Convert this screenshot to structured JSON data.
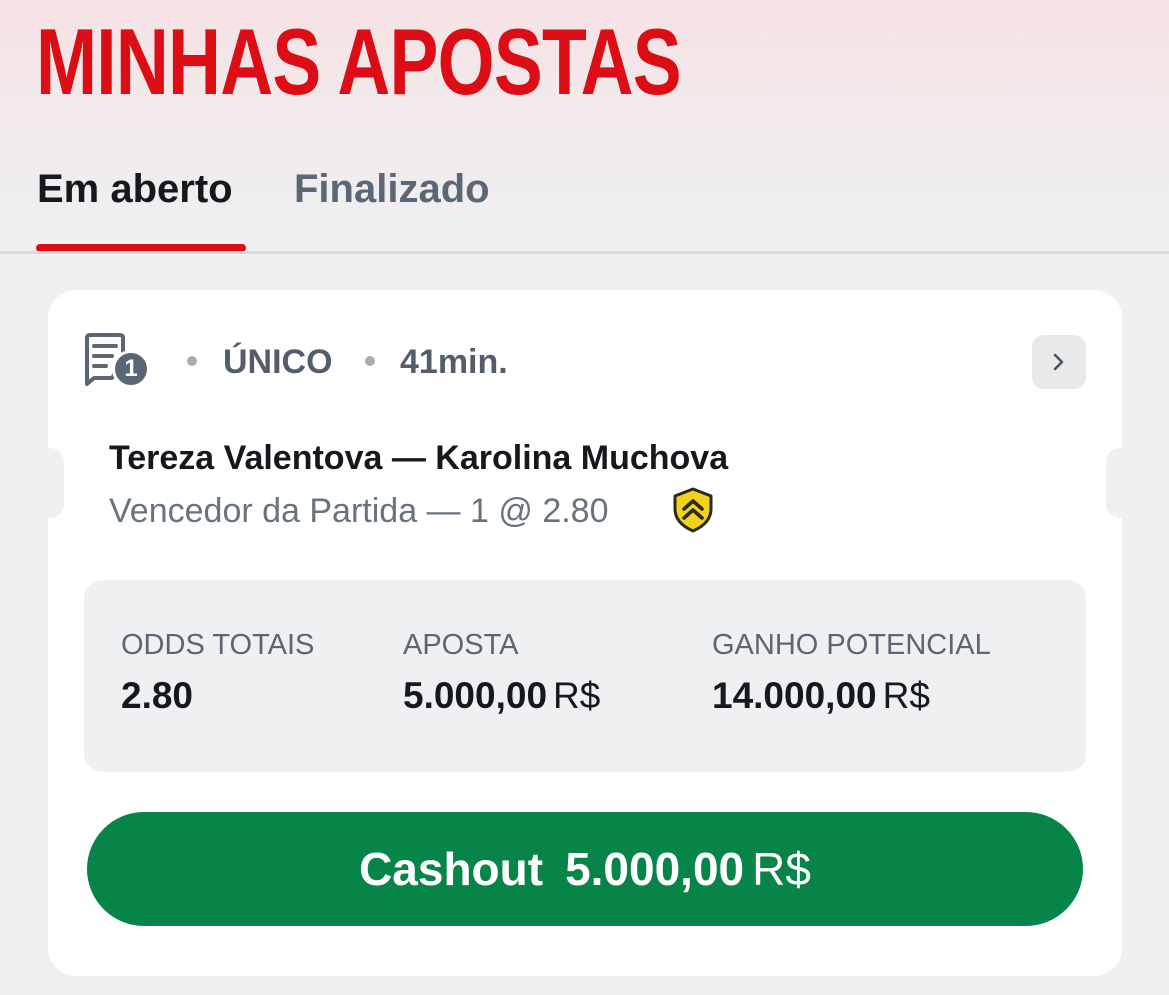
{
  "header": {
    "title": "MINHAS APOSTAS"
  },
  "tabs": [
    {
      "label": "Em aberto",
      "active": true
    },
    {
      "label": "Finalizado",
      "active": false
    }
  ],
  "bet": {
    "selections_count": "1",
    "type": "ÚNICO",
    "time": "41min.",
    "match": "Tereza Valentova — Karolina Muchova",
    "market": "Vencedor da Partida — 1 @ 2.80",
    "boost_icon": "shield-boost-icon",
    "summary": {
      "odds_label": "ODDS TOTAIS",
      "odds_value": "2.80",
      "stake_label": "APOSTA",
      "stake_value": "5.000,00",
      "stake_currency": "R$",
      "potential_label": "GANHO POTENCIAL",
      "potential_value": "14.000,00",
      "potential_currency": "R$"
    },
    "cashout": {
      "label": "Cashout",
      "amount": "5.000,00",
      "currency": "R$"
    }
  },
  "colors": {
    "brand_red": "#dc0d14",
    "cashout_green": "#078548",
    "boost_yellow": "#f2d31c"
  }
}
